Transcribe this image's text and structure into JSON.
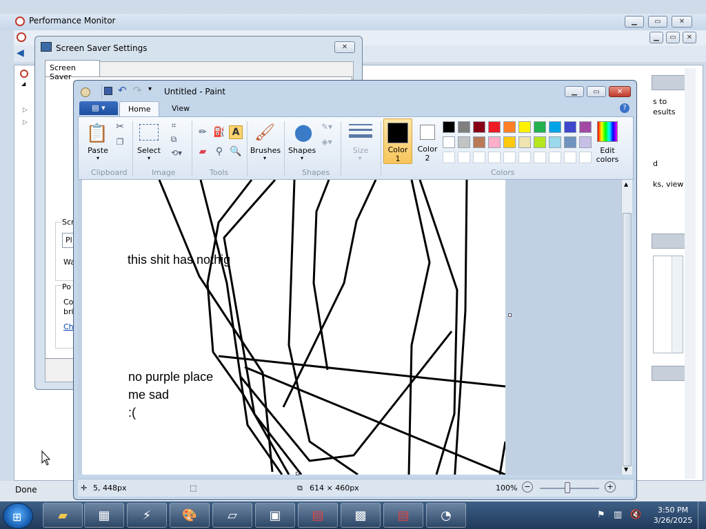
{
  "perfmon": {
    "title": "Performance Monitor",
    "status": "Done",
    "right_fragments": [
      "s to",
      "esults",
      "d",
      "ks, view"
    ]
  },
  "screensaver": {
    "title": "Screen Saver Settings",
    "tab": "Screen Saver",
    "fragments": [
      "Scr",
      "Pl",
      "Wa",
      "Po",
      "Co",
      "bri",
      "Ch"
    ]
  },
  "paint": {
    "title": "Untitled - Paint",
    "tabs": {
      "home": "Home",
      "view": "View"
    },
    "groups": {
      "clipboard": "Clipboard",
      "image": "Image",
      "tools": "Tools",
      "shapes": "Shapes",
      "colors": "Colors"
    },
    "buttons": {
      "paste": "Paste",
      "select": "Select",
      "brushes": "Brushes",
      "shapes": "Shapes",
      "size": "Size",
      "color1": "Color 1",
      "color1_num": "1",
      "color1_word": "Color",
      "color2_word": "Color",
      "color2_num": "2",
      "edit_colors_1": "Edit",
      "edit_colors_2": "colors"
    },
    "palette_row1": [
      "#000000",
      "#7f7f7f",
      "#880015",
      "#ed1c24",
      "#ff7f27",
      "#fff200",
      "#22b14c",
      "#00a2e8",
      "#3f48cc",
      "#a349a4"
    ],
    "palette_row2": [
      "#ffffff",
      "#c3c3c3",
      "#b97a57",
      "#ffaec9",
      "#ffc90e",
      "#efe4b0",
      "#b5e61d",
      "#99d9ea",
      "#7092be",
      "#c8bfe7"
    ],
    "canvas_text": {
      "line1": "this shit has nothig",
      "line2": "no purple place",
      "line3": "me sad",
      "line4": ":("
    },
    "status": {
      "cursor": "5, 448px",
      "size": "614 × 460px",
      "zoom": "100%"
    }
  },
  "taskbar": {
    "time": "3:50 PM",
    "date": "3/26/2025"
  }
}
